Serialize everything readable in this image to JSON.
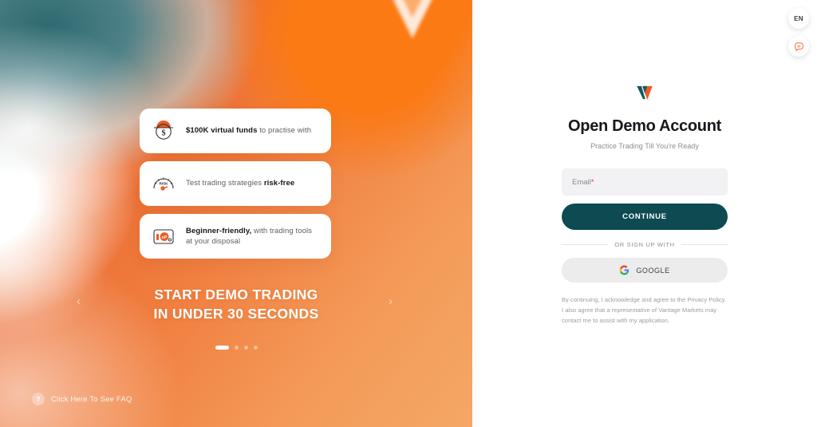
{
  "promo": {
    "logo_icon": "vantage-v-logo-icon",
    "features": [
      {
        "icon": "piggy-bank-dollar-icon",
        "strong": "$100K virtual funds",
        "rest": " to practise with"
      },
      {
        "icon": "risk-gauge-icon",
        "pre": "Test trading strategies ",
        "strong": "risk-free"
      },
      {
        "icon": "trading-tools-icon",
        "strong": "Beginner-friendly,",
        "rest": " with trading tools at your disposal"
      }
    ],
    "headline_line1": "START DEMO TRADING",
    "headline_line2": "IN UNDER 30 SECONDS",
    "prev_arrow": "‹",
    "next_arrow": "›",
    "dots_total": 4,
    "dots_active_index": 0,
    "faq_badge": "?",
    "faq_label": "Click Here To See FAQ"
  },
  "topbar": {
    "language_label": "EN",
    "chat_icon": "chat-bubble-icon"
  },
  "form": {
    "brand_logo_icon": "vantage-v-logo-icon",
    "title": "Open Demo Account",
    "subtitle": "Practice Trading Till You're Ready",
    "email_label": "Email",
    "email_required_mark": "*",
    "email_value": "",
    "email_placeholder": "Email",
    "continue_label": "CONTINUE",
    "divider_label": "OR SIGN UP WITH",
    "google_label": "GOOGLE",
    "google_icon": "google-g-icon",
    "disclaimer": "By continuing, I acknowledge and agree to the Privacy Policy. I also agree that a representative of Vantage Markets may contact me to assist with my application."
  },
  "colors": {
    "brand_orange": "#fb7a14",
    "brand_teal": "#0e4a52",
    "promo_gradient_from": "#e1582a",
    "promo_gradient_to": "#f5a765",
    "field_bg": "#f2f2f4",
    "google_bg": "#ececed",
    "required_red": "#e23b2e"
  }
}
